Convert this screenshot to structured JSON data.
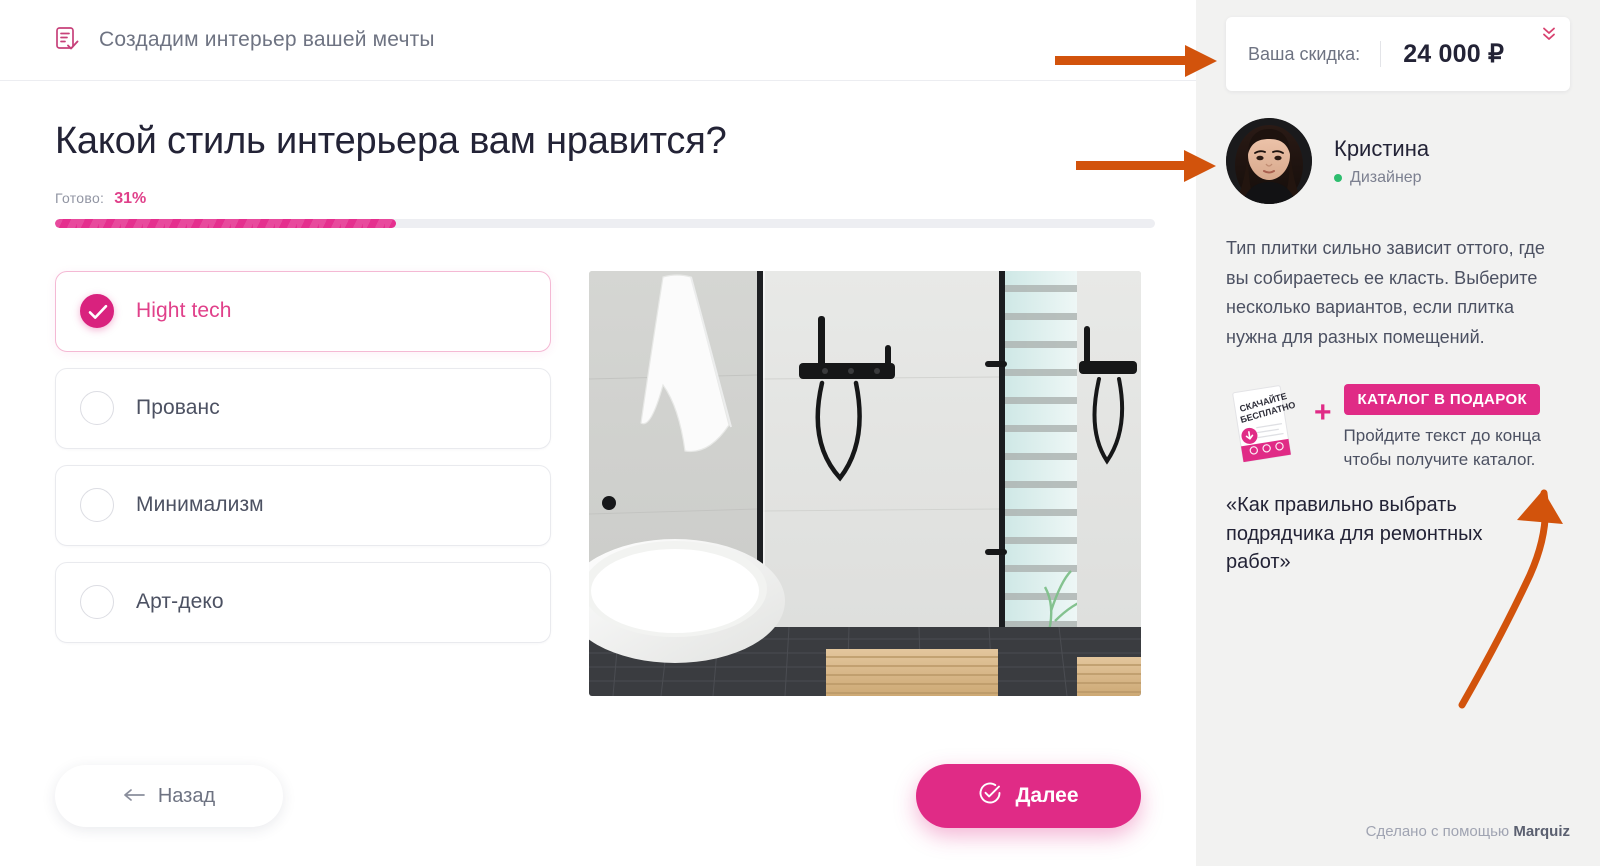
{
  "header": {
    "icon": "document-check-icon",
    "title": "Создадим интерьер вашей мечты"
  },
  "quiz": {
    "question": "Какой стиль интерьера вам нравится?",
    "progress_label": "Готово:",
    "progress_value": "31%",
    "progress_percent": 31,
    "options": [
      {
        "label": "Hight tech",
        "selected": true
      },
      {
        "label": "Прованс",
        "selected": false
      },
      {
        "label": "Минимализм",
        "selected": false
      },
      {
        "label": "Арт-деко",
        "selected": false
      }
    ],
    "image_alt": "bathroom-interior-photo"
  },
  "actions": {
    "back_label": "Назад",
    "back_icon": "arrow-left-icon",
    "next_label": "Далее",
    "next_icon": "check-circle-icon"
  },
  "sidebar": {
    "discount": {
      "label": "Ваша скидка:",
      "value": "24 000 ₽",
      "chevron_icon": "chevron-double-down-icon"
    },
    "designer": {
      "name": "Кристина",
      "role": "Дизайнер",
      "status_color": "#2dbd6e",
      "avatar": "designer-avatar"
    },
    "tip_text": "Тип плитки сильно зависит оттого, где вы собираетесь ее класть. Выберите несколько вариантов, если плитка нужна для разных помещений.",
    "promo": {
      "book_line1": "СКАЧАЙТЕ",
      "book_line2": "БЕСПЛАТНО",
      "plus": "+",
      "badge": "КАТАЛОГ В ПОДАРОК",
      "sub": "Пройдите текст до конца чтобы получите каталог."
    },
    "quote": "«Как правильно выбрать подрядчика для ремонтных работ»",
    "footer": {
      "made_with": "Сделано с помощью ",
      "brand": "Marquiz"
    }
  },
  "annotations": {
    "arrow_color": "#d2530c",
    "arrow_discount": "arrow-right-to-discount",
    "arrow_designer": "arrow-right-to-designer",
    "arrow_catalog": "curved-arrow-to-catalog"
  },
  "theme": {
    "accent": "#e02b86",
    "accent_dark": "#d9227e",
    "text_dark": "#232336",
    "text_muted": "#6e7382",
    "sidebar_bg": "#f2f2f1",
    "border": "#e9eaee"
  }
}
